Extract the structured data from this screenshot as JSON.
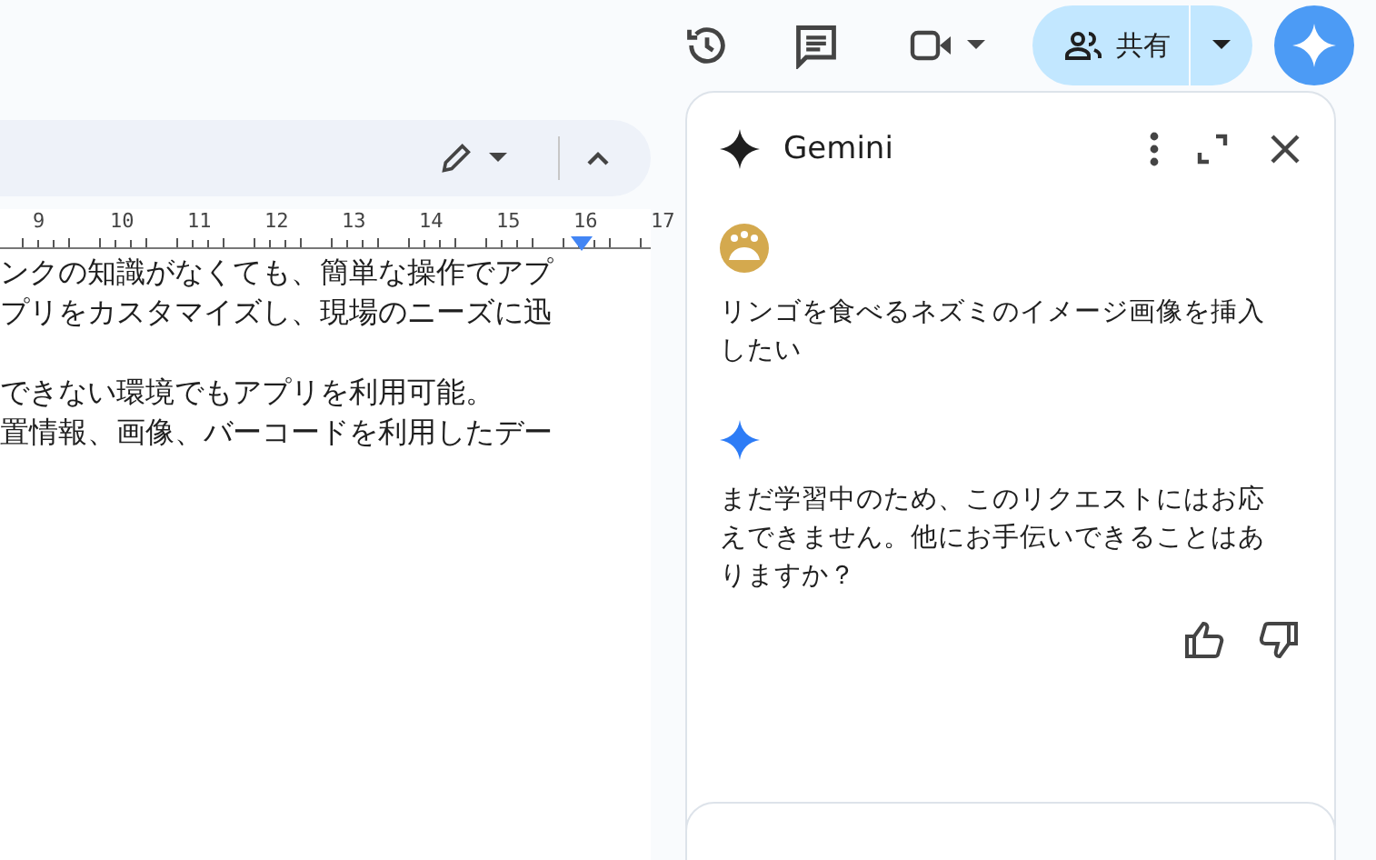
{
  "top_bar": {
    "share_button": {
      "label": "共有"
    }
  },
  "ruler": {
    "labels": [
      "9",
      "10",
      "11",
      "12",
      "13",
      "14",
      "15",
      "16",
      "17"
    ]
  },
  "document": {
    "paragraphs": [
      {
        "lines": [
          "ンクの知識がなくても、簡単な操作でアプ",
          "プリをカスタマイズし、現場のニーズに迅"
        ]
      },
      {
        "lines": [
          "できない環境でもアプリを利用可能。",
          "置情報、画像、バーコードを利用したデー"
        ]
      }
    ]
  },
  "gemini_panel": {
    "title": "Gemini",
    "messages": [
      {
        "kind": "user",
        "text": "リンゴを食べるネズミのイメージ画像を挿入したい"
      },
      {
        "kind": "model",
        "text": "まだ学習中のため、このリクエストにはお応えできません。他にお手伝いできることはありますか？"
      }
    ]
  }
}
